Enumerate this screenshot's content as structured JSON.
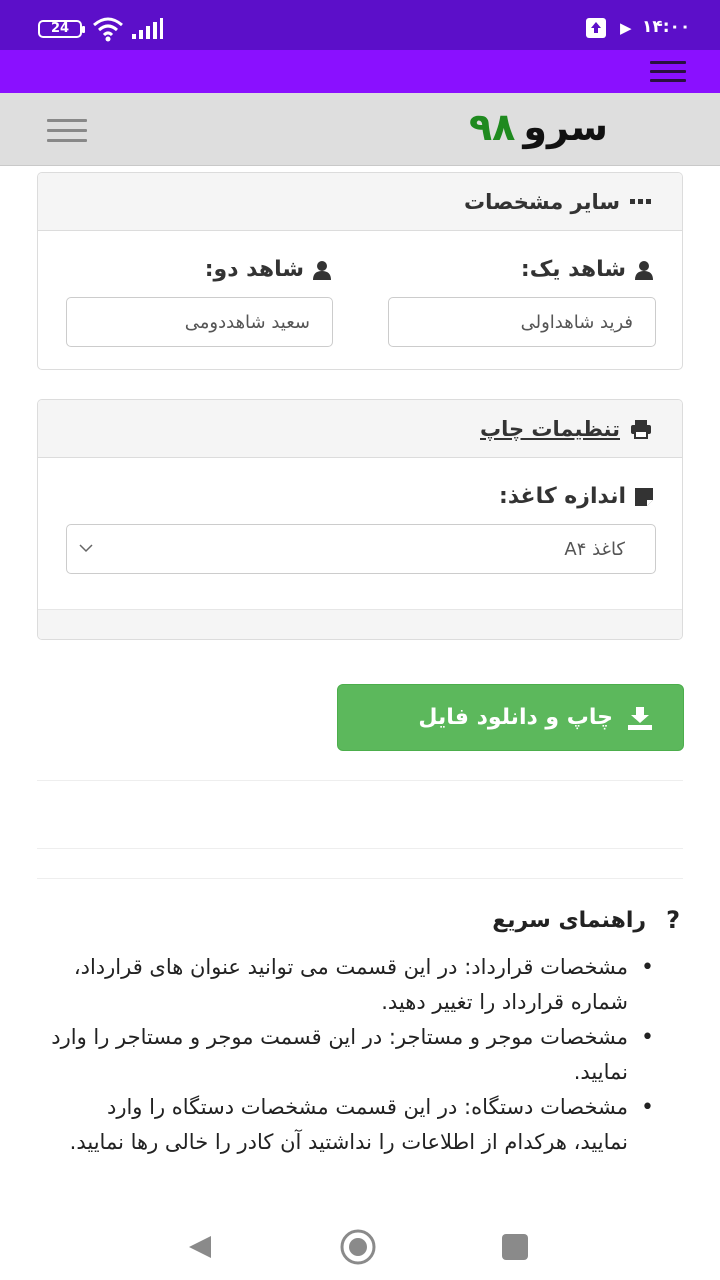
{
  "status_bar": {
    "battery": "24",
    "time": "۱۴:۰۰",
    "icons": [
      "wifi-icon",
      "signal-icon",
      "upload-icon",
      "play-icon"
    ]
  },
  "header": {
    "logo_text": "سرو",
    "logo_number": "۹۸",
    "logo_colors": {
      "text": "#111111",
      "number": "#1f8a1f"
    }
  },
  "witnesses_panel": {
    "title": "سایر مشخصات",
    "witness_one": {
      "label": "شاهد یک:",
      "value": "فرید شاهداولی"
    },
    "witness_two": {
      "label": "شاهد دو:",
      "value": "سعید شاهددومی"
    }
  },
  "print_panel": {
    "title": "تنظیمات چاپ",
    "paper_size": {
      "label": "اندازه کاغذ:",
      "selected": "کاغذ A۴"
    }
  },
  "download_button": {
    "label": "چاپ و دانلود فایل",
    "color": "#5cb85c"
  },
  "help": {
    "title": "راهنمای سریع",
    "items": [
      "مشخصات قرارداد: در این قسمت می توانید عنوان های قرارداد، شماره قرارداد را تغییر دهید.",
      "مشخصات موجر و مستاجر: در این قسمت موجر و مستاجر را وارد نمایید.",
      "مشخصات دستگاه: در این قسمت مشخصات دستگاه را وارد نمایید، هرکدام از اطلاعات را نداشتید آن کادر را خالی رها نمایید."
    ]
  },
  "colors": {
    "status_bar": "#5c0fc9",
    "toolbar": "#8a10ff",
    "header": "#dedede"
  }
}
